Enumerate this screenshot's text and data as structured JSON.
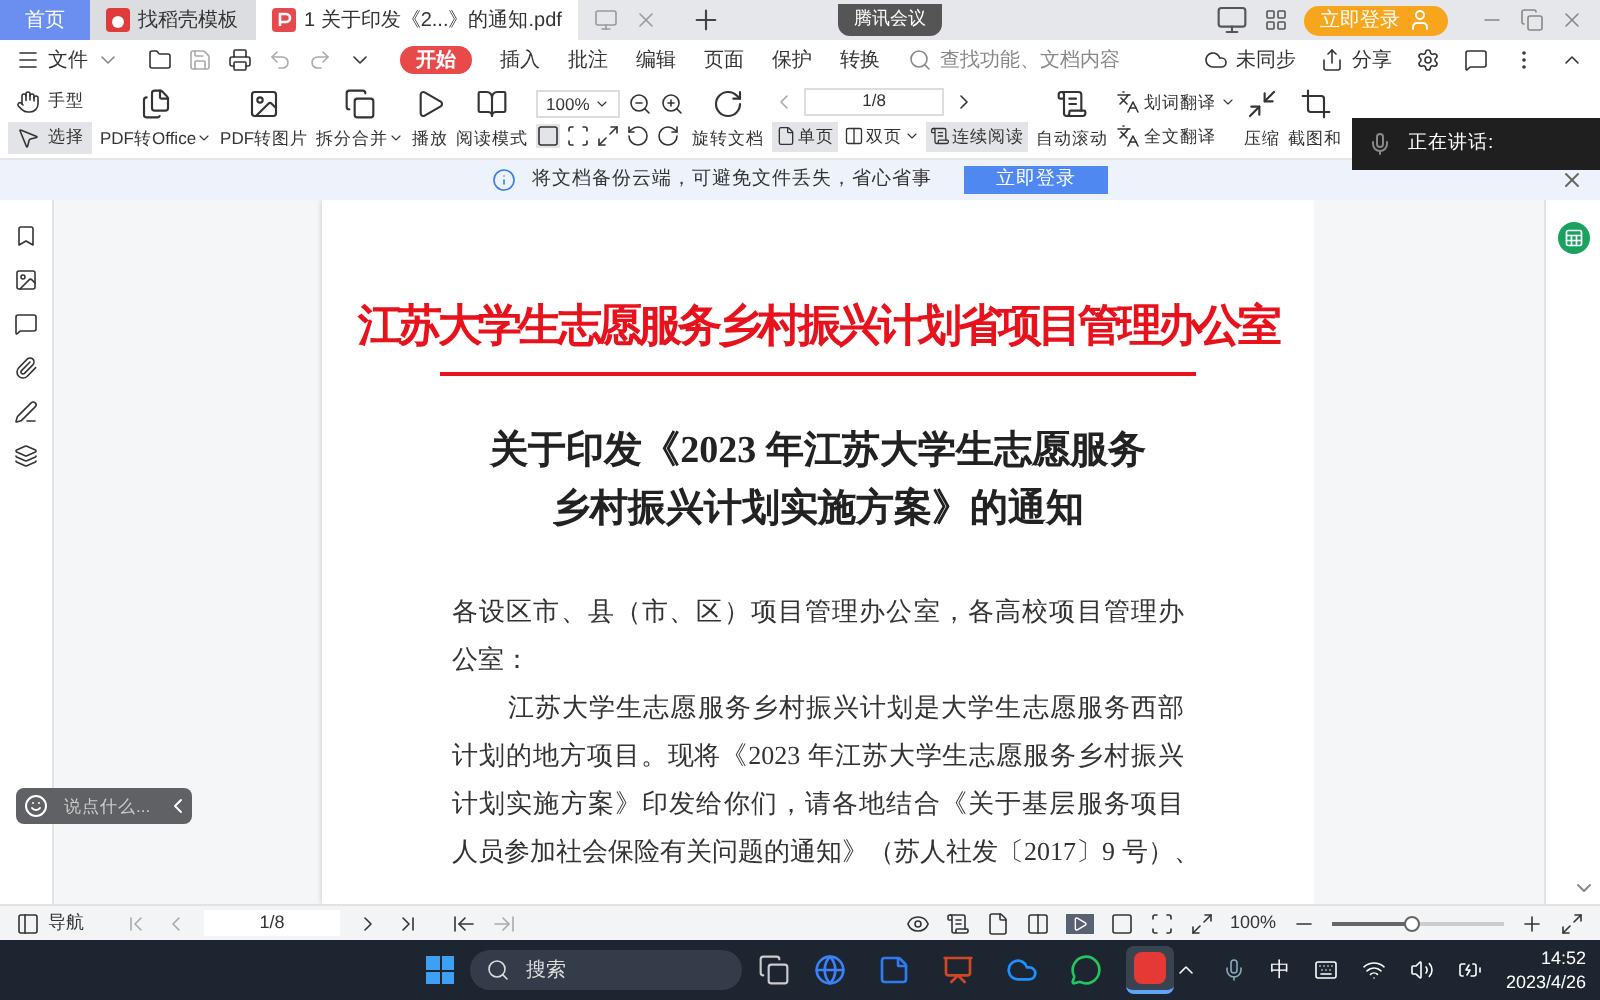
{
  "tabs": [
    {
      "label": "首页",
      "kind": "home",
      "selected": false
    },
    {
      "label": "找稻壳模板",
      "kind": "template",
      "selected": false
    },
    {
      "label": "1 关于印发《2...》的通知.pdf",
      "kind": "pdf",
      "selected": true
    }
  ],
  "meeting": {
    "label": "腾讯会议"
  },
  "login_button": "立即登录",
  "menu": {
    "file": "文件",
    "items": [
      {
        "label": "开始",
        "selected": true
      },
      {
        "label": "插入",
        "selected": false
      },
      {
        "label": "批注",
        "selected": false
      },
      {
        "label": "编辑",
        "selected": false
      },
      {
        "label": "页面",
        "selected": false
      },
      {
        "label": "保护",
        "selected": false
      },
      {
        "label": "转换",
        "selected": false
      }
    ],
    "search": {
      "placeholder": "查找功能、文档内容"
    },
    "sync": "未同步",
    "share": "分享"
  },
  "toolbar": {
    "pointer_tools": [
      {
        "label": "手型",
        "kind": "hand",
        "selected": false
      },
      {
        "label": "选择",
        "kind": "select",
        "selected": true
      }
    ],
    "tools": [
      {
        "label": "PDF转Office",
        "kind": "office",
        "dropdown": true
      },
      {
        "label": "PDF转图片",
        "kind": "image",
        "dropdown": false
      },
      {
        "label": "拆分合并",
        "kind": "split",
        "dropdown": true
      },
      {
        "label": "播放",
        "kind": "play",
        "dropdown": false
      },
      {
        "label": "阅读模式",
        "kind": "read",
        "dropdown": false
      }
    ],
    "zoom": {
      "value": "100%"
    },
    "rotate": "旋转文档",
    "page": {
      "value": "1/8"
    },
    "views": [
      {
        "label": "单页",
        "kind": "single",
        "selected": true,
        "dropdown": false
      },
      {
        "label": "双页",
        "kind": "double",
        "selected": false,
        "dropdown": true
      },
      {
        "label": "连续阅读",
        "kind": "continuous",
        "selected": true,
        "dropdown": false
      }
    ],
    "autoscroll": "自动滚动",
    "translate": [
      {
        "label": "划词翻译",
        "dropdown": true
      },
      {
        "label": "全文翻译",
        "dropdown": false
      }
    ],
    "more": [
      {
        "label": "压缩",
        "kind": "compress"
      },
      {
        "label": "截图和",
        "kind": "screenshot"
      }
    ]
  },
  "speaking_overlay": {
    "label": "正在讲话:"
  },
  "notice": {
    "text": "将文档备份云端，可避免文件丢失，省心省事",
    "button": "立即登录"
  },
  "document": {
    "header": "江苏大学生志愿服务乡村振兴计划省项目管理办公室",
    "title_lines": [
      "关于印发《2023 年江苏大学生志愿服务",
      "乡村振兴计划实施方案》的通知"
    ],
    "paragraphs": [
      {
        "indent": false,
        "lines": [
          "各设区市、县（市、区）项目管理办公室，各高校项目管理办",
          "公室："
        ]
      },
      {
        "indent": true,
        "lines": [
          "江苏大学生志愿服务乡村振兴计划是大学生志愿服务西部",
          "计划的地方项目。现将《2023 年江苏大学生志愿服务乡村振兴",
          "计划实施方案》印发给你们，请各地结合《关于基层服务项目",
          "人员参加社会保险有关问题的通知》（苏人社发〔2017〕9 号）、"
        ]
      }
    ]
  },
  "comment_pill": {
    "placeholder": "说点什么..."
  },
  "status_bar": {
    "nav": "导航",
    "page": "1/8",
    "zoom": "100%",
    "zoom_slider": {
      "level": 0.47
    }
  },
  "taskbar": {
    "search": {
      "placeholder": "搜索"
    },
    "apps": [
      {
        "kind": "browser",
        "color": "#3b82f6",
        "selected": false
      },
      {
        "kind": "notes",
        "color": "#2f7bf0",
        "selected": false
      },
      {
        "kind": "slides",
        "color": "#d24726",
        "selected": false
      },
      {
        "kind": "cloud",
        "color": "#1e90ff",
        "selected": false
      },
      {
        "kind": "chat",
        "color": "#22c55e",
        "selected": false
      },
      {
        "kind": "wps",
        "color": "#e53935",
        "selected": true
      }
    ],
    "ime": "中",
    "time": "14:52",
    "date": "2023/4/26"
  }
}
